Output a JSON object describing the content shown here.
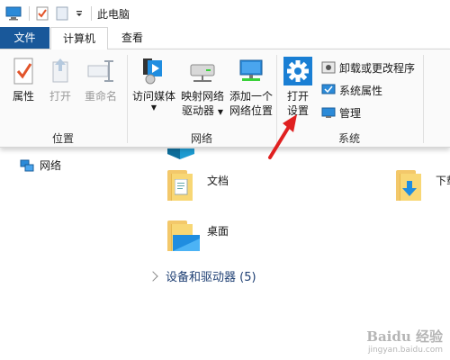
{
  "title": "此电脑",
  "tabs": {
    "file": "文件",
    "computer": "计算机",
    "view": "查看"
  },
  "ribbon": {
    "location": {
      "label": "位置",
      "properties": "属性",
      "open": "打开",
      "rename": "重命名"
    },
    "network": {
      "label": "网络",
      "access_media": "访问媒体",
      "map_drive_line1": "映射网络",
      "map_drive_line2": "驱动器",
      "add_location_line1": "添加一个",
      "add_location_line2": "网络位置"
    },
    "system": {
      "label": "系统",
      "open_settings_line1": "打开",
      "open_settings_line2": "设置",
      "uninstall": "卸载或更改程序",
      "system_properties": "系统属性",
      "manage": "管理"
    }
  },
  "nav": {
    "network": "网络"
  },
  "content": {
    "documents": "文档",
    "downloads": "下载",
    "desktop": "桌面",
    "devices_header": "设备和驱动器 (5)"
  },
  "colors": {
    "file_tab": "#19589a",
    "settings_icon": "#1a7fd4",
    "arrow": "#e02020"
  },
  "watermark": {
    "main": "Baidu 经验",
    "sub": "jingyan.baidu.com"
  }
}
